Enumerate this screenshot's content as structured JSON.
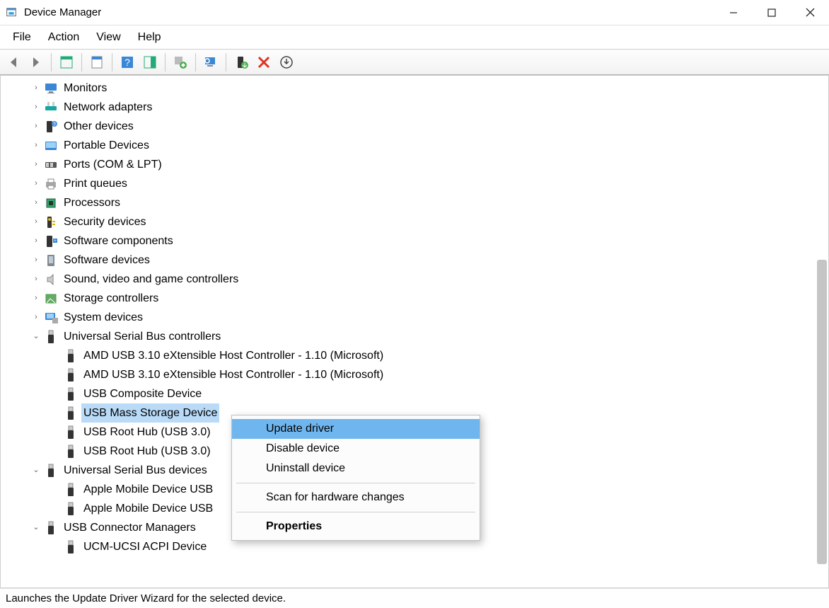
{
  "window": {
    "title": "Device Manager"
  },
  "menu": {
    "file": "File",
    "action": "Action",
    "view": "View",
    "help": "Help"
  },
  "toolbar": {
    "back": "back-icon",
    "forward": "forward-icon",
    "show_hidden": "show-hide-console-tree-icon",
    "properties": "properties-icon",
    "help": "help-icon",
    "action_center": "action-center-icon",
    "update_driver": "update-driver-icon",
    "monitor_refresh": "monitor-refresh-icon",
    "enable": "enable-icon",
    "disable": "delete-icon",
    "scan": "scan-download-icon"
  },
  "tree": {
    "categories": [
      {
        "label": "Monitors",
        "icon": "monitor-icon",
        "expandable": true
      },
      {
        "label": "Network adapters",
        "icon": "network-icon",
        "expandable": true
      },
      {
        "label": "Other devices",
        "icon": "other-device-icon",
        "expandable": true
      },
      {
        "label": "Portable Devices",
        "icon": "portable-icon",
        "expandable": true
      },
      {
        "label": "Ports (COM & LPT)",
        "icon": "port-icon",
        "expandable": true
      },
      {
        "label": "Print queues",
        "icon": "printer-icon",
        "expandable": true
      },
      {
        "label": "Processors",
        "icon": "cpu-icon",
        "expandable": true
      },
      {
        "label": "Security devices",
        "icon": "security-icon",
        "expandable": true
      },
      {
        "label": "Software components",
        "icon": "software-component-icon",
        "expandable": true
      },
      {
        "label": "Software devices",
        "icon": "software-device-icon",
        "expandable": true
      },
      {
        "label": "Sound, video and game controllers",
        "icon": "sound-icon",
        "expandable": true
      },
      {
        "label": "Storage controllers",
        "icon": "storage-icon",
        "expandable": true
      },
      {
        "label": "System devices",
        "icon": "system-icon",
        "expandable": true
      },
      {
        "label": "Universal Serial Bus controllers",
        "icon": "usb-icon",
        "expanded": true,
        "children": [
          {
            "label": "AMD USB 3.10 eXtensible Host Controller - 1.10 (Microsoft)",
            "icon": "usb-icon"
          },
          {
            "label": "AMD USB 3.10 eXtensible Host Controller - 1.10 (Microsoft)",
            "icon": "usb-icon"
          },
          {
            "label": "USB Composite Device",
            "icon": "usb-icon"
          },
          {
            "label": "USB Mass Storage Device",
            "icon": "usb-icon",
            "selected": true
          },
          {
            "label": "USB Root Hub (USB 3.0)",
            "icon": "usb-icon"
          },
          {
            "label": "USB Root Hub (USB 3.0)",
            "icon": "usb-icon"
          }
        ]
      },
      {
        "label": "Universal Serial Bus devices",
        "icon": "usb-icon",
        "expanded": true,
        "children": [
          {
            "label": "Apple Mobile Device USB",
            "icon": "usb-icon"
          },
          {
            "label": "Apple Mobile Device USB",
            "icon": "usb-icon"
          }
        ]
      },
      {
        "label": "USB Connector Managers",
        "icon": "usb-icon",
        "expanded": true,
        "children": [
          {
            "label": "UCM-UCSI ACPI Device",
            "icon": "usb-icon"
          }
        ]
      }
    ]
  },
  "context_menu": {
    "items": [
      {
        "label": "Update driver",
        "highlighted": true
      },
      {
        "label": "Disable device"
      },
      {
        "label": "Uninstall device"
      },
      {
        "separator": true
      },
      {
        "label": "Scan for hardware changes"
      },
      {
        "separator": true
      },
      {
        "label": "Properties",
        "bold": true
      }
    ]
  },
  "statusbar": {
    "text": "Launches the Update Driver Wizard for the selected device."
  }
}
